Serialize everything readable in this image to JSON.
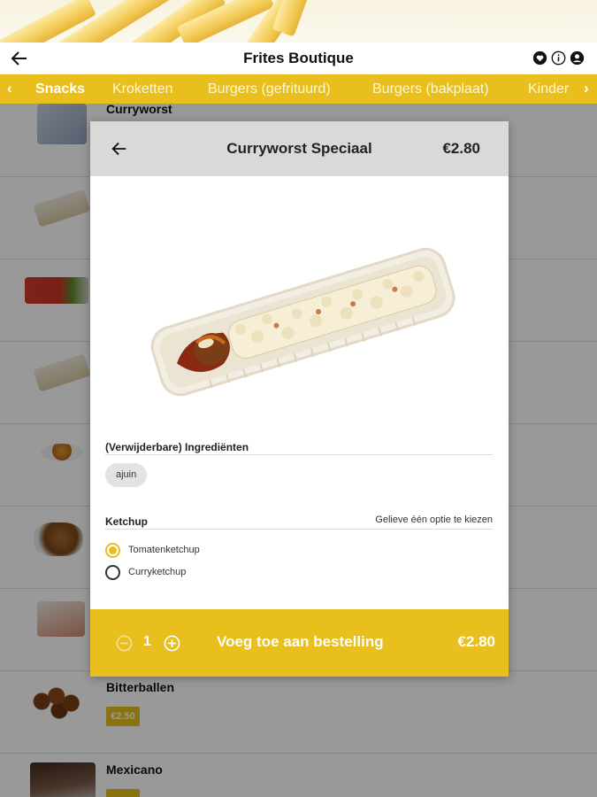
{
  "app": {
    "title": "Frites Boutique"
  },
  "categories": {
    "items": [
      "Snacks",
      "Kroketten",
      "Burgers (gefrituurd)",
      "Burgers (bakplaat)",
      "Kinder"
    ],
    "active_index": 0
  },
  "list": {
    "items": [
      {
        "name": "Curryworst",
        "price": ""
      },
      {
        "name": "",
        "price": ""
      },
      {
        "name": "",
        "price": ""
      },
      {
        "name": "",
        "price": ""
      },
      {
        "name": "",
        "price": ""
      },
      {
        "name": "",
        "price": ""
      },
      {
        "name": "",
        "price": ""
      },
      {
        "name": "Bitterballen",
        "price": "€2.50"
      },
      {
        "name": "Mexicano",
        "price": ""
      }
    ]
  },
  "modal": {
    "title": "Curryworst Speciaal",
    "price": "€2.80",
    "ingredients_title": "(Verwijderbare) Ingrediënten",
    "ingredients": [
      "ajuin"
    ],
    "ketchup_title": "Ketchup",
    "ketchup_hint": "Gelieve één optie te kiezen",
    "options": [
      {
        "label": "Tomatenketchup",
        "selected": true
      },
      {
        "label": "Curryketchup",
        "selected": false
      }
    ],
    "footer": {
      "quantity": "1",
      "add_label": "Voeg toe aan bestelling",
      "price": "€2.80"
    }
  },
  "colors": {
    "accent": "#e8bf1c",
    "header_grey": "#d9d9d9"
  }
}
